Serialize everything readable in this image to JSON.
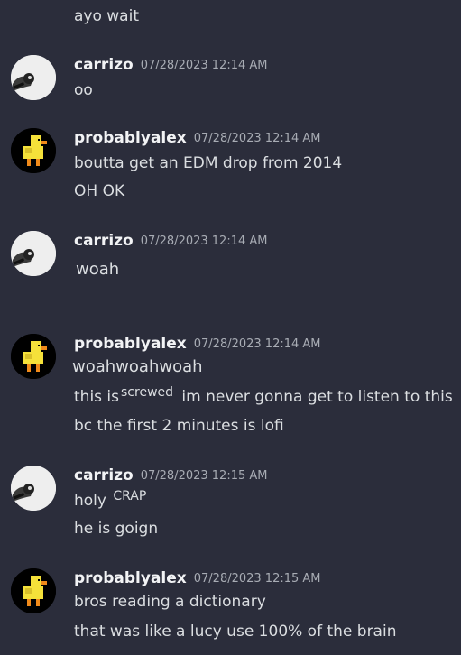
{
  "messages": {
    "m0_line1": "ayo wait",
    "m1": {
      "user": "carrizo",
      "time": "07/28/2023 12:14 AM",
      "line1": "oo"
    },
    "m2": {
      "user": "probablyalex",
      "time": "07/28/2023 12:14 AM",
      "line1": "boutta get an EDM drop from 2014",
      "line2": "OH OK"
    },
    "m3": {
      "user": "carrizo",
      "time": "07/28/2023 12:14 AM",
      "line1": "woah"
    },
    "m4": {
      "user": "probablyalex",
      "time": "07/28/2023 12:14 AM",
      "line1": "woahwoahwoah",
      "line2_pre": "this is",
      "line2_sup": "screwed",
      "line2_post": " im never gonna get to listen to this",
      "line3": "bc the first 2 minutes is lofi"
    },
    "m5": {
      "user": "carrizo",
      "time": "07/28/2023 12:15 AM",
      "line1_pre": "holy ",
      "line1_sup": "CRAP",
      "line2": "he is goign"
    },
    "m6": {
      "user": "probablyalex",
      "time": "07/28/2023 12:15 AM",
      "line1": "bros reading a dictionary",
      "line2": "that was like a lucy use 100% of the brain"
    }
  },
  "avatars": {
    "carrizo": "bird-with-headphones-avatar",
    "probablyalex": "pixel-duck-avatar"
  },
  "colors": {
    "background": "#2b2d3b",
    "text": "#dbdee1",
    "username": "#f2f3f5",
    "timestamp": "#a8acb4"
  }
}
